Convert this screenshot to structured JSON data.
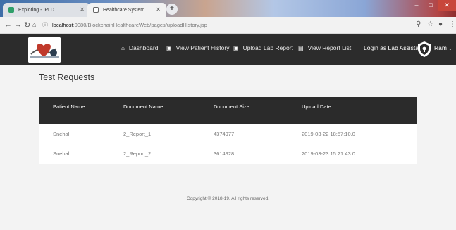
{
  "browser": {
    "tabs": [
      {
        "title": "Exploring - IPLD"
      },
      {
        "title": "Healthcare System"
      }
    ],
    "new_tab": "+",
    "url_host": "localhost",
    "url_rest": ":9080/BlockchainHealthcareWeb/pages/uploadHistory.jsp"
  },
  "nav": {
    "items": [
      {
        "label": "Dashboard"
      },
      {
        "label": "View Patient History"
      },
      {
        "label": "Upload Lab Report"
      },
      {
        "label": "View Report List"
      }
    ],
    "login_text": "Login as Lab Assistant",
    "user": "Ram"
  },
  "page": {
    "title": "Test Requests",
    "columns": [
      "Patient Name",
      "Document Name",
      "Document Size",
      "Upload Date"
    ],
    "rows": [
      {
        "patient": "Snehal",
        "document": "2_Report_1",
        "size": "4374977",
        "date": "2019-03-22 18:57:10.0"
      },
      {
        "patient": "Snehal",
        "document": "2_Report_2",
        "size": "3614928",
        "date": "2019-03-23 15:21:43.0"
      }
    ],
    "footer": "Copyright © 2018-19. All rights reserved."
  }
}
